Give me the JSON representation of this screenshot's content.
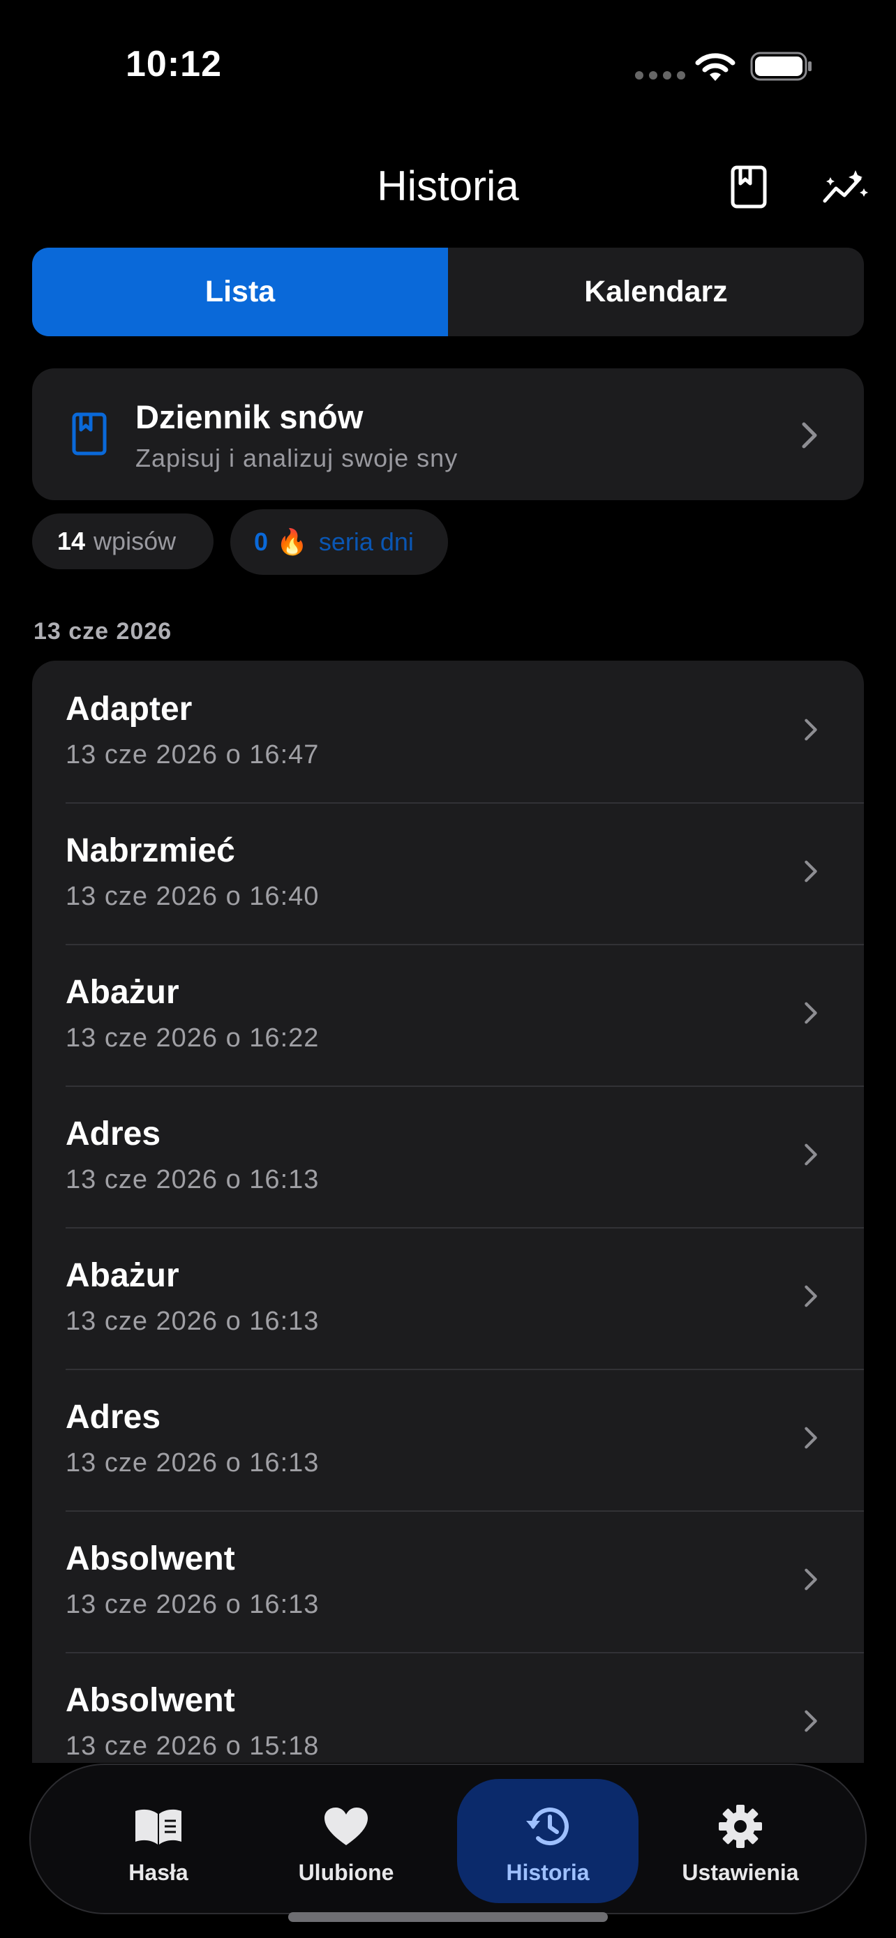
{
  "status": {
    "time": "10:12"
  },
  "header": {
    "title": "Historia",
    "journal_icon": "bookmark-book-icon",
    "stats_icon": "sparkle-chart-icon"
  },
  "segment": {
    "list_label": "Lista",
    "calendar_label": "Kalendarz"
  },
  "journal": {
    "title": "Dziennik snów",
    "subtitle": "Zapisuj i analizuj swoje sny"
  },
  "stats": {
    "entries_count": "14",
    "entries_label": "wpisów",
    "streak_count": "0",
    "streak_emoji": "🔥",
    "streak_label": "seria dni"
  },
  "list": {
    "date_header": "13 cze 2026",
    "rows": [
      {
        "title": "Adapter",
        "date": "13 cze 2026 o 16:47"
      },
      {
        "title": "Nabrzmieć",
        "date": "13 cze 2026 o 16:40"
      },
      {
        "title": "Abażur",
        "date": "13 cze 2026 o 16:22"
      },
      {
        "title": "Adres",
        "date": "13 cze 2026 o 16:13"
      },
      {
        "title": "Abażur",
        "date": "13 cze 2026 o 16:13"
      },
      {
        "title": "Adres",
        "date": "13 cze 2026 o 16:13"
      },
      {
        "title": "Absolwent",
        "date": "13 cze 2026 o 16:13"
      },
      {
        "title": "Absolwent",
        "date": "13 cze 2026 o 15:18"
      }
    ]
  },
  "tabs": [
    {
      "label": "Hasła",
      "icon": "book-icon"
    },
    {
      "label": "Ulubione",
      "icon": "heart-icon"
    },
    {
      "label": "Historia",
      "icon": "history-icon",
      "active": true
    },
    {
      "label": "Ustawienia",
      "icon": "gear-icon"
    }
  ],
  "colors": {
    "accent": "#0a69d9",
    "card": "#1c1c1e",
    "background": "#000000",
    "active_tab": "#0b2a6b"
  }
}
